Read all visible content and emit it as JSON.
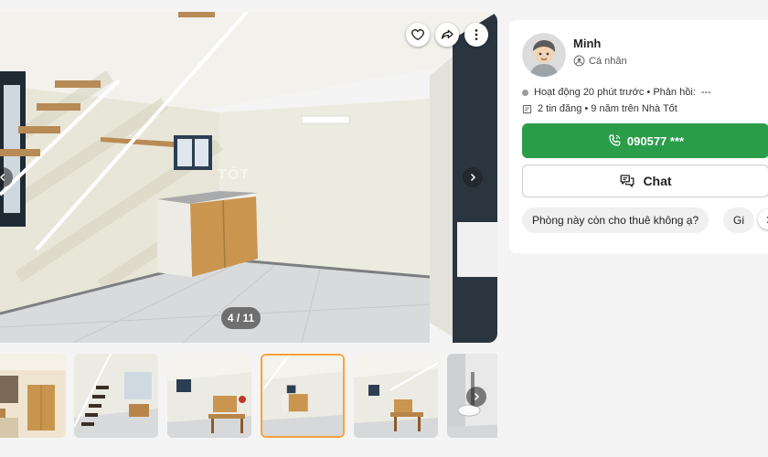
{
  "gallery": {
    "counter": "4 / 11",
    "watermark": "TỐT",
    "current_index": 4,
    "total_images": 11,
    "thumbnails": [
      {
        "name": "thumbnail-1"
      },
      {
        "name": "thumbnail-2"
      },
      {
        "name": "thumbnail-3"
      },
      {
        "name": "thumbnail-4",
        "active": true
      },
      {
        "name": "thumbnail-5"
      },
      {
        "name": "thumbnail-6"
      }
    ],
    "icons": {
      "favorite": "heart-icon",
      "share": "share-icon",
      "more": "more-vertical-icon",
      "prev": "chevron-left-icon",
      "next": "chevron-right-icon"
    }
  },
  "seller": {
    "name": "Minh",
    "type": "Cá nhân",
    "activity": "Hoạt động 20 phút trước • Phản hồi:",
    "response_rate": "---",
    "listings": "2 tin đăng • 9 năm trên Nhà Tốt"
  },
  "actions": {
    "phone": "090577 ***",
    "chat": "Chat"
  },
  "quick_replies": [
    "Phòng này còn cho thuê không ạ?",
    "Gi"
  ],
  "colors": {
    "call_button": "#2a9d4a",
    "active_thumb_border": "#f7a23b",
    "page_background": "#f4f4f4"
  }
}
